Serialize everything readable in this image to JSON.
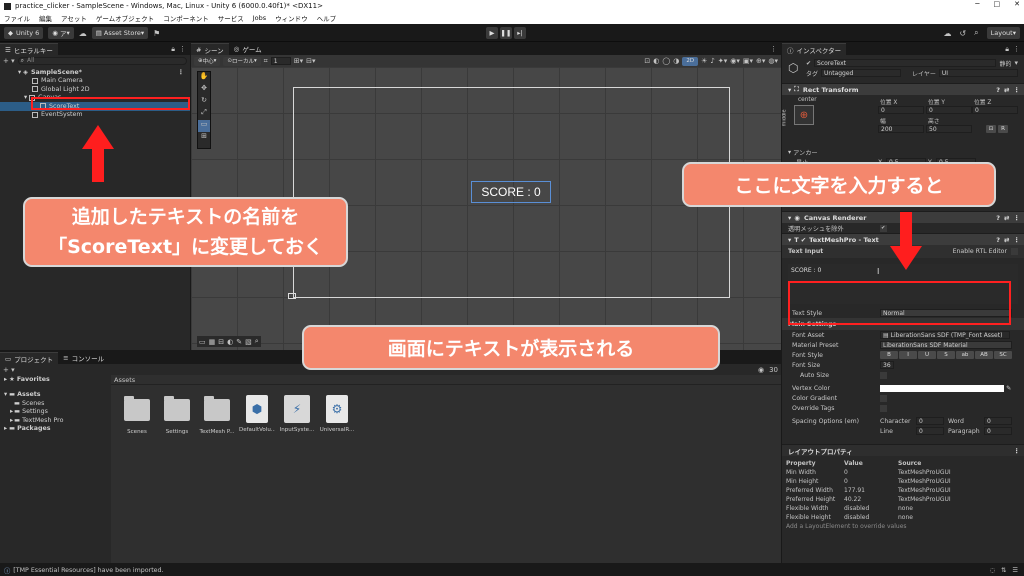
{
  "window": {
    "title": "practice_clicker - SampleScene - Windows, Mac, Linux - Unity 6 (6000.0.40f1)* <DX11>",
    "min": "─",
    "max": "□",
    "close": "✕"
  },
  "menu": [
    "ファイル",
    "編集",
    "アセット",
    "ゲームオブジェクト",
    "コンポーネント",
    "サービス",
    "Jobs",
    "ウィンドウ",
    "ヘルプ"
  ],
  "toolbar": {
    "unity": "Unity 6",
    "account": "ア",
    "asset_store": "Asset Store",
    "layout": "Layout"
  },
  "hierarchy": {
    "tab": "ヒエラルキー",
    "search_placeholder": "All",
    "scene": "SampleScene*",
    "items": [
      "Main Camera",
      "Global Light 2D",
      "Canvas",
      "ScoreText",
      "EventSystem"
    ]
  },
  "scene": {
    "tab_scene": "シーン",
    "tab_game": "ゲーム",
    "pivot": "中心",
    "space": "ローカル",
    "grid_num": "1",
    "mode_2d": "2D",
    "score_text": "SCORE : 0"
  },
  "project": {
    "tab_project": "プロジェクト",
    "tab_console": "コンソール",
    "favorites": "Favorites",
    "assets": "Assets",
    "tree": [
      "Scenes",
      "Settings",
      "TextMesh Pro"
    ],
    "packages": "Packages",
    "breadcrumb": "Assets",
    "count": "30",
    "files": [
      "Scenes",
      "Settings",
      "TextMesh P...",
      "DefaultVolu...",
      "InputSyste...",
      "UniversalR..."
    ]
  },
  "inspector": {
    "tab": "インスペクター",
    "object_name": "ScoreText",
    "static": "静的",
    "tag_label": "タグ",
    "tag": "Untagged",
    "layer_label": "レイヤー",
    "layer": "UI",
    "rect": {
      "header": "Rect Transform",
      "anchor": "center",
      "side": "middle",
      "pos_x_label": "位置 X",
      "pos_y_label": "位置 Y",
      "pos_z_label": "位置 Z",
      "pos_x": "0",
      "pos_y": "0",
      "pos_z": "0",
      "w_label": "幅",
      "h_label": "高さ",
      "w": "200",
      "h": "50",
      "anchors": "アンカー",
      "min": "最小",
      "min_x_label": "X",
      "min_x": "0.5",
      "min_y_label": "Y",
      "min_y": "0.5",
      "r_btn": "R"
    },
    "canvas_renderer": {
      "header": "Canvas Renderer",
      "cull": "透明メッシュを除外"
    },
    "tmp": {
      "header": "TextMeshPro - Text",
      "text_input": "Text Input",
      "rtl": "Enable RTL Editor",
      "text": "SCORE : 0",
      "text_style_label": "Text Style",
      "text_style": "Normal",
      "main_settings": "Main Settings",
      "font_asset_label": "Font Asset",
      "font_asset": "LiberationSans SDF (TMP_Font Asset)",
      "material_label": "Material Preset",
      "material": "LiberationSans SDF Material",
      "font_style_label": "Font Style",
      "font_style_btns": [
        "B",
        "I",
        "U",
        "S",
        "ab",
        "AB",
        "SC"
      ],
      "font_size_label": "Font Size",
      "font_size": "36",
      "auto_size": "Auto Size",
      "vertex_color": "Vertex Color",
      "color_gradient": "Color Gradient",
      "override_tags": "Override Tags",
      "spacing": "Spacing Options (em)",
      "character": "Character",
      "character_v": "0",
      "word": "Word",
      "word_v": "0",
      "line": "Line",
      "line_v": "0",
      "paragraph": "Paragraph",
      "paragraph_v": "0"
    },
    "layout": {
      "header": "レイアウトプロパティ",
      "cols": [
        "Property",
        "Value",
        "Source"
      ],
      "rows": [
        [
          "Min Width",
          "0",
          "TextMeshProUGUI"
        ],
        [
          "Min Height",
          "0",
          "TextMeshProUGUI"
        ],
        [
          "Preferred Width",
          "177.91",
          "TextMeshProUGUI"
        ],
        [
          "Preferred Height",
          "40.22",
          "TextMeshProUGUI"
        ],
        [
          "Flexible Width",
          "disabled",
          "none"
        ],
        [
          "Flexible Height",
          "disabled",
          "none"
        ]
      ],
      "footer": "Add a LayoutElement to override values"
    }
  },
  "status": "[TMP Essential Resources] have been imported.",
  "callouts": {
    "left_line1": "追加したテキストの名前を",
    "left_line2": "「ScoreText」に変更しておく",
    "right": "ここに文字を入力すると",
    "bottom": "画面にテキストが表示される"
  },
  "colors": {
    "callout": "#f4876d",
    "highlight": "#ff2020",
    "selection": "#2c5d87"
  }
}
